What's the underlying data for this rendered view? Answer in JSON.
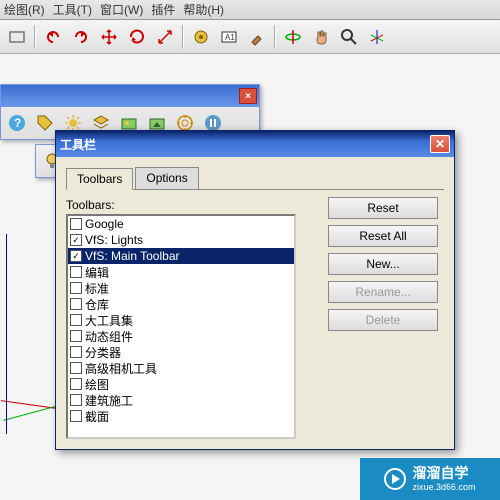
{
  "menu": {
    "items": [
      "绘图(R)",
      "工具(T)",
      "窗口(W)",
      "插件",
      "帮助(H)"
    ]
  },
  "dialog": {
    "title": "工具栏",
    "tabs": [
      "Toolbars",
      "Options"
    ],
    "active_tab": 0,
    "list_label": "Toolbars:",
    "items": [
      {
        "label": "Google",
        "checked": false,
        "selected": false
      },
      {
        "label": "VfS: Lights",
        "checked": true,
        "selected": false
      },
      {
        "label": "VfS: Main Toolbar",
        "checked": true,
        "selected": true
      },
      {
        "label": "编辑",
        "checked": false,
        "selected": false
      },
      {
        "label": "标准",
        "checked": false,
        "selected": false
      },
      {
        "label": "仓库",
        "checked": false,
        "selected": false
      },
      {
        "label": "大工具集",
        "checked": false,
        "selected": false
      },
      {
        "label": "动态组件",
        "checked": false,
        "selected": false
      },
      {
        "label": "分类器",
        "checked": false,
        "selected": false
      },
      {
        "label": "高级相机工具",
        "checked": false,
        "selected": false
      },
      {
        "label": "绘图",
        "checked": false,
        "selected": false
      },
      {
        "label": "建筑施工",
        "checked": false,
        "selected": false
      },
      {
        "label": "截面",
        "checked": false,
        "selected": false
      }
    ],
    "buttons": {
      "reset": "Reset",
      "reset_all": "Reset All",
      "new": "New...",
      "rename": "Rename...",
      "delete": "Delete"
    }
  },
  "watermark": {
    "line1": "溜溜自学",
    "line2": "zixue.3d66.com"
  }
}
